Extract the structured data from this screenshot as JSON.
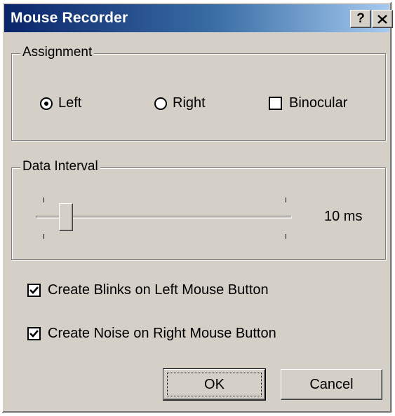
{
  "window": {
    "title": "Mouse Recorder",
    "help_label": "?"
  },
  "assignment": {
    "legend": "Assignment",
    "options": [
      {
        "label": "Left",
        "type": "radio",
        "checked": true
      },
      {
        "label": "Right",
        "type": "radio",
        "checked": false
      },
      {
        "label": "Binocular",
        "type": "checkbox",
        "checked": false
      }
    ]
  },
  "data_interval": {
    "legend": "Data Interval",
    "value_label": "10 ms",
    "slider_position_fraction": 0.12
  },
  "options": [
    {
      "label": "Create Blinks on Left Mouse Button",
      "checked": true
    },
    {
      "label": "Create Noise on Right Mouse Button",
      "checked": true
    }
  ],
  "buttons": {
    "ok": "OK",
    "cancel": "Cancel"
  },
  "colors": {
    "dialog_face": "#d4d0c8",
    "title_gradient_start": "#0a246a",
    "title_gradient_end": "#a6caf0"
  }
}
